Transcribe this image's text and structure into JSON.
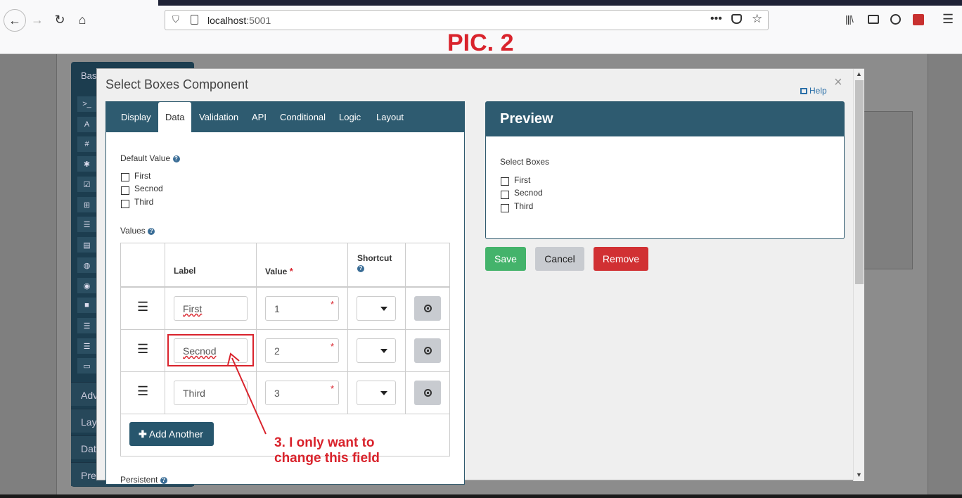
{
  "browser": {
    "url_host": "localhost",
    "url_port": ":5001"
  },
  "annotation_title": "PIC. 2",
  "annotation_note_line1": "3. I only want to",
  "annotation_note_line2": "change this field",
  "sidebar": {
    "icons": [
      ">_",
      "A",
      "#",
      "✱",
      "☑",
      "⊞",
      "☰",
      "▤",
      "◍",
      "◉",
      "■",
      "☰",
      "☰",
      "▭"
    ],
    "categories": [
      "Adv",
      "Lay",
      "Dat",
      "Pre"
    ],
    "top_label": "Bas"
  },
  "modal": {
    "title": "Select Boxes Component",
    "help": "Help",
    "close": "×",
    "tabs": [
      "Display",
      "Data",
      "Validation",
      "API",
      "Conditional",
      "Logic",
      "Layout"
    ],
    "active_tab": "Data",
    "default_value_label": "Default Value",
    "default_options": [
      "First",
      "Secnod",
      "Third"
    ],
    "values_label": "Values",
    "table": {
      "headers": {
        "label": "Label",
        "value": "Value",
        "shortcut": "Shortcut"
      },
      "rows": [
        {
          "label": "First",
          "value": "1"
        },
        {
          "label": "Secnod",
          "value": "2"
        },
        {
          "label": "Third",
          "value": "3"
        }
      ],
      "add_button": "Add Another"
    },
    "persistent_label": "Persistent",
    "preview": {
      "title": "Preview",
      "field_label": "Select Boxes",
      "options": [
        "First",
        "Secnod",
        "Third"
      ]
    },
    "buttons": {
      "save": "Save",
      "cancel": "Cancel",
      "remove": "Remove"
    }
  }
}
